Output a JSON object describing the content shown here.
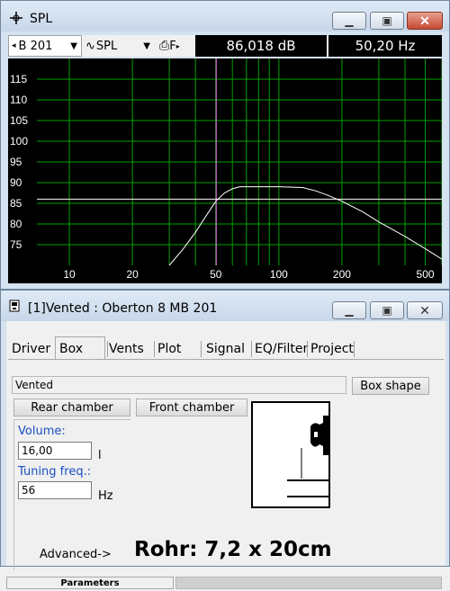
{
  "spl_window": {
    "title": "SPL",
    "toolbar": {
      "driver_select": "B 201",
      "graph_select": "SPL",
      "print_label": "F",
      "readout_level": "86,018 dB",
      "readout_freq": "50,20 Hz"
    },
    "chart_data": {
      "type": "line",
      "xscale": "log",
      "xlim": [
        7,
        600
      ],
      "ylim": [
        70,
        120
      ],
      "x_tick_labels": [
        "10",
        "20",
        "50",
        "100",
        "200",
        "500"
      ],
      "y_tick_labels": [
        "115",
        "110",
        "105",
        "100",
        "95",
        "90",
        "85",
        "80",
        "75"
      ],
      "grid": true,
      "colors": {
        "grid": "#00a000",
        "curve": "#ffffff",
        "cursor": "#ff80ff",
        "background": "#000000",
        "ticks": "#ffffff"
      },
      "series": [
        {
          "x": [
            30,
            35,
            40,
            45,
            50,
            55,
            60,
            65,
            70,
            80,
            100,
            130,
            150,
            170,
            200,
            250,
            300,
            400,
            500,
            600
          ],
          "y": [
            70,
            74,
            78,
            82,
            85.5,
            87.5,
            88.5,
            89,
            89,
            89,
            89,
            88.8,
            88,
            87,
            85.5,
            83,
            80.5,
            77,
            74,
            71.5
          ]
        }
      ],
      "cursor": {
        "x": 50.2,
        "y": 86.018
      }
    }
  },
  "box_window": {
    "title": "[1]Vented : Oberton 8 MB 201",
    "tabs": [
      "Driver",
      "Box",
      "Vents",
      "Plot",
      "Signal",
      "EQ/Filter",
      "Project"
    ],
    "box_type_value": "Vented",
    "box_shape_label": "Box shape",
    "rear_chamber_label": "Rear chamber",
    "front_chamber_label": "Front chamber",
    "volume_label": "Volume:",
    "volume_value": "16,00",
    "volume_unit": "l",
    "tuning_label": "Tuning freq.:",
    "tuning_value": "56",
    "tuning_unit": "Hz",
    "advanced_label": "Advanced->",
    "note_text": "Rohr: 7,2 x 20cm",
    "status_label": "Parameters"
  }
}
